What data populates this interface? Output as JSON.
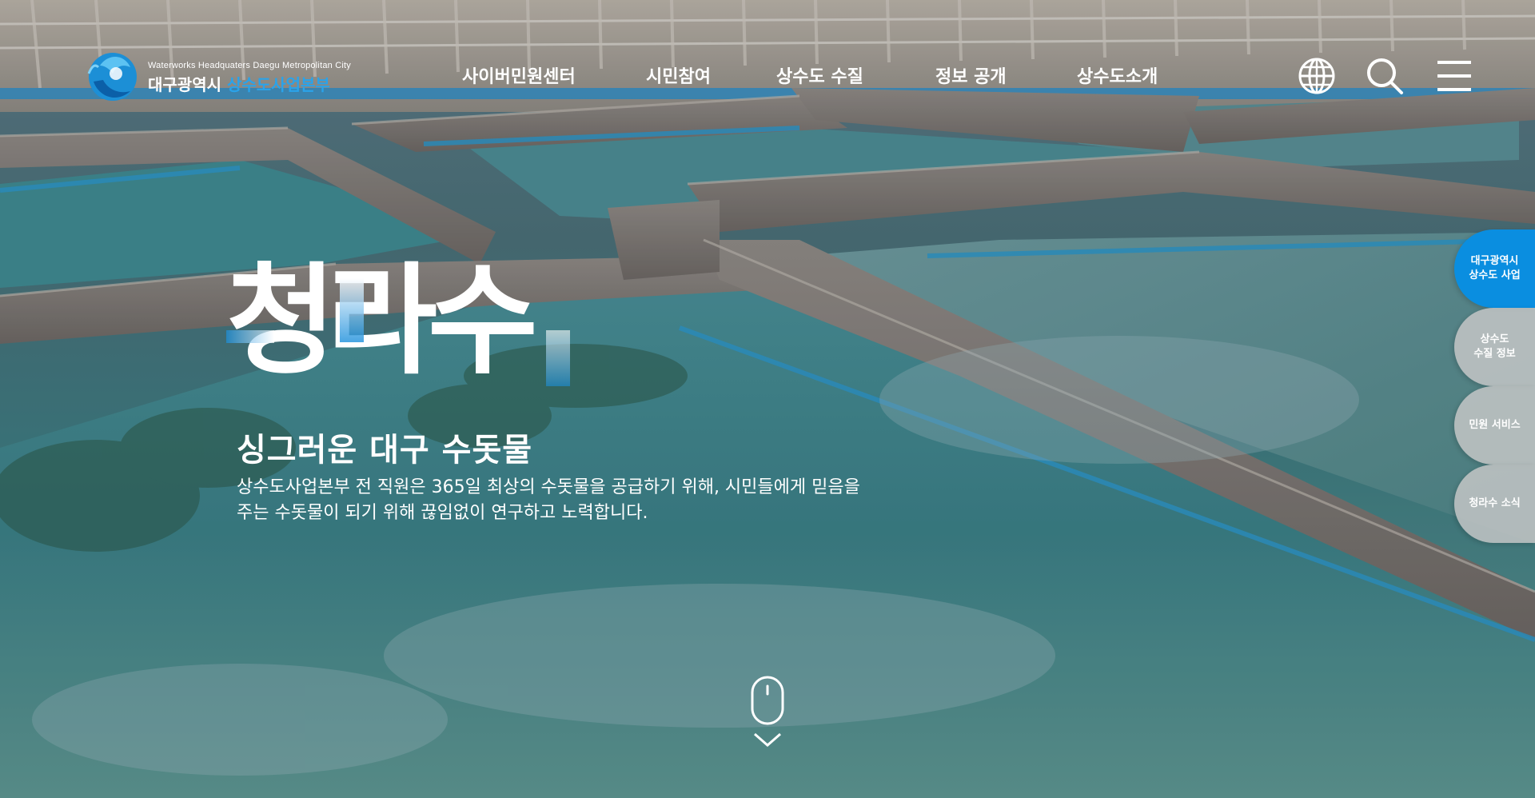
{
  "header": {
    "logo": {
      "sub_en": "Waterworks Headquaters Daegu Metropolitan City",
      "name_prefix": "대구광역시",
      "name_accent": "상수도사업본부"
    },
    "nav": [
      {
        "label": "사이버민원센터"
      },
      {
        "label": "시민참여"
      },
      {
        "label": "상수도 수질"
      },
      {
        "label": "정보 공개"
      },
      {
        "label": "상수도소개"
      }
    ],
    "utility_icons": [
      "globe-icon",
      "search-icon",
      "menu-icon"
    ]
  },
  "hero": {
    "brand_title": "청라수",
    "subtitle": "싱그러운 대구 수돗물",
    "description": "상수도사업본부 전 직원은 365일 최상의 수돗물을 공급하기 위해, 시민들에게 믿음을 주는 수돗물이 되기 위해 끊임없이 연구하고 노력합니다."
  },
  "quick_menu": [
    {
      "label": "대구광역시\n상수도 사업",
      "active": true
    },
    {
      "label": "상수도\n수질 정보",
      "active": false
    },
    {
      "label": "민원 서비스",
      "active": false
    },
    {
      "label": "청라수 소식",
      "active": false
    }
  ],
  "colors": {
    "accent": "#0a8ee0",
    "logo_accent": "#2aa3ea",
    "quick_inactive": "#c8c8c8"
  }
}
